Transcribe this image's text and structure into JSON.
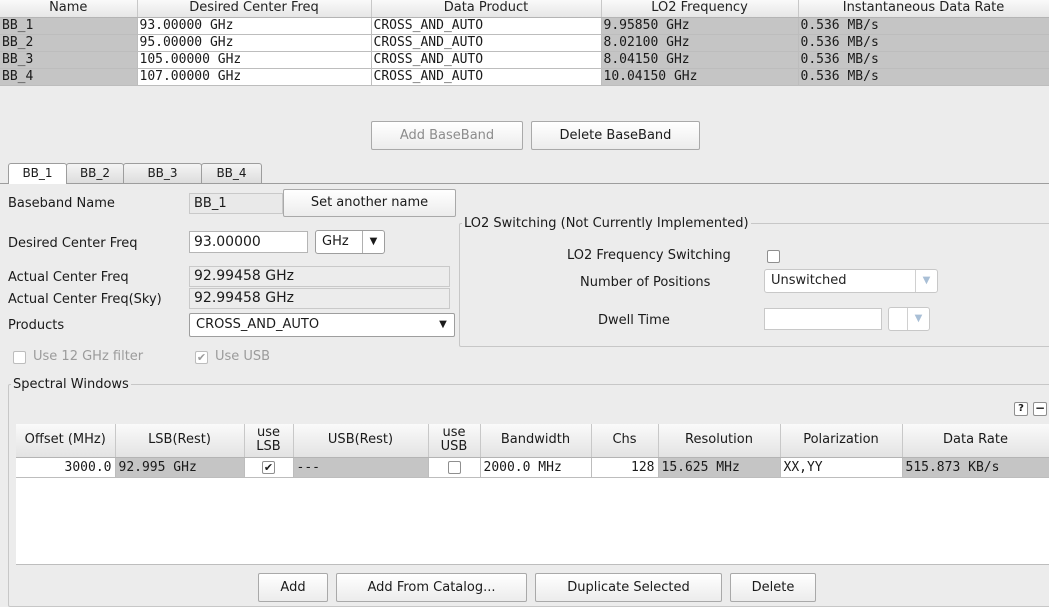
{
  "baseband_table": {
    "headers": [
      "Name",
      "Desired Center Freq",
      "Data Product",
      "LO2 Frequency",
      "Instantaneous Data Rate"
    ],
    "rows": [
      [
        "BB_1",
        "93.00000 GHz",
        "CROSS_AND_AUTO",
        "9.95850 GHz",
        "0.536 MB/s"
      ],
      [
        "BB_2",
        "95.00000 GHz",
        "CROSS_AND_AUTO",
        "8.02100 GHz",
        "0.536 MB/s"
      ],
      [
        "BB_3",
        "105.00000 GHz",
        "CROSS_AND_AUTO",
        "8.04150 GHz",
        "0.536 MB/s"
      ],
      [
        "BB_4",
        "107.00000 GHz",
        "CROSS_AND_AUTO",
        "10.04150 GHz",
        "0.536 MB/s"
      ]
    ]
  },
  "baseband_buttons": {
    "add": "Add BaseBand",
    "delete": "Delete BaseBand"
  },
  "tabs": [
    "BB_1",
    "BB_2",
    "BB_3",
    "BB_4"
  ],
  "form": {
    "baseband_name_label": "Baseband Name",
    "baseband_name_value": "BB_1",
    "set_name_button": "Set another name",
    "desired_center_label": "Desired Center Freq",
    "desired_center_value": "93.00000",
    "desired_center_unit": "GHz",
    "actual_center_label": "Actual Center Freq",
    "actual_center_value": "92.99458 GHz",
    "actual_center_sky_label": "Actual Center Freq(Sky)",
    "actual_center_sky_value": "92.99458 GHz",
    "products_label": "Products",
    "products_value": "CROSS_AND_AUTO",
    "use_12ghz_label": "Use 12 GHz filter",
    "use_usb_label": "Use USB",
    "use_usb_checked": "✔"
  },
  "lo2": {
    "legend": "LO2 Switching (Not Currently Implemented)",
    "freq_switching_label": "LO2 Frequency Switching",
    "positions_label": "Number of Positions",
    "positions_value": "Unswitched",
    "dwell_label": "Dwell Time",
    "dwell_value": ""
  },
  "spectral": {
    "legend": "Spectral Windows",
    "help": "?",
    "collapse": "−",
    "headers": [
      "Offset (MHz)",
      "LSB(Rest)",
      "use LSB",
      "USB(Rest)",
      "use USB",
      "Bandwidth",
      "Chs",
      "Resolution",
      "Polarization",
      "Data Rate"
    ],
    "row": {
      "offset": "3000.0",
      "lsb_rest": "92.995 GHz",
      "use_lsb": "✔",
      "usb_rest": "---",
      "use_usb": "",
      "bandwidth": "2000.0 MHz",
      "chs": "128",
      "resolution": "15.625 MHz",
      "polarization": "XX,YY",
      "data_rate": "515.873 KB/s"
    }
  },
  "bottom_buttons": {
    "add": "Add",
    "add_catalog": "Add From Catalog...",
    "duplicate": "Duplicate Selected",
    "delete": "Delete"
  }
}
